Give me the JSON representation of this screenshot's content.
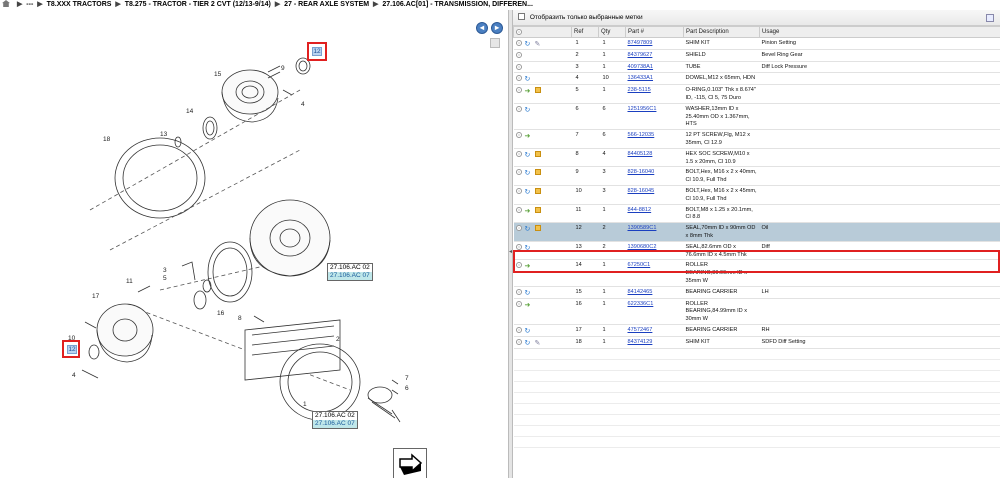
{
  "breadcrumb": {
    "items": [
      "---",
      "T8.XXX TRACTORS",
      "T8.275 - TRACTOR - TIER 2 CVT (12/13-9/14)",
      "27 - REAR AXLE SYSTEM",
      "27.106.AC[01] - TRANSMISSION, DIFFEREN..."
    ]
  },
  "diagram": {
    "nav_prev": "◂",
    "nav_next": "▸",
    "labels": [
      "15",
      "9",
      "12",
      "14",
      "4",
      "13",
      "18",
      "3",
      "5",
      "11",
      "17",
      "16",
      "8",
      "2",
      "10",
      "12",
      "4",
      "7",
      "6",
      "1"
    ],
    "ref_box_1": {
      "code": "27.106.AC 02",
      "link": "27.106.AC 07"
    },
    "ref_box_2": {
      "code": "27.106.AC 02",
      "link": "27.106.AC 07"
    },
    "callout_top": "12",
    "callout_left": "12"
  },
  "table": {
    "filter_label": "Отобразить только выбранные метки",
    "columns": [
      "",
      "Ref",
      "Qty",
      "Part #",
      "Part Description",
      "Usage"
    ],
    "rows": [
      {
        "icons": [
          "cycle",
          "wrench"
        ],
        "ref": "1",
        "qty": "1",
        "part": "87497809",
        "desc": "SHIM KIT",
        "usage": "Pinion Setting"
      },
      {
        "icons": [],
        "ref": "2",
        "qty": "1",
        "part": "84379627",
        "desc": "SHIELD",
        "usage": "Bevel Ring Gear"
      },
      {
        "icons": [],
        "ref": "3",
        "qty": "1",
        "part": "409738A1",
        "desc": "TUBE",
        "usage": "Diff Lock Pressure"
      },
      {
        "icons": [
          "cycle"
        ],
        "ref": "4",
        "qty": "10",
        "part": "136433A1",
        "desc": "DOWEL,M12 x 65mm, HDN",
        "usage": ""
      },
      {
        "icons": [
          "cart",
          "box"
        ],
        "ref": "5",
        "qty": "1",
        "part": "238-5115",
        "desc": "O-RING,0.103\" Thk x 8.674\" ID, -115, Cl 5, 75 Duro",
        "usage": ""
      },
      {
        "icons": [
          "cycle"
        ],
        "ref": "6",
        "qty": "6",
        "part": "1251956C1",
        "desc": "WASHER,13mm ID x 25.40mm OD x 1.367mm, HTS",
        "usage": ""
      },
      {
        "icons": [
          "cart"
        ],
        "ref": "7",
        "qty": "6",
        "part": "566-12035",
        "desc": "12 PT SCREW,Flg, M12 x 35mm, Cl 12.9",
        "usage": ""
      },
      {
        "icons": [
          "cycle",
          "box"
        ],
        "ref": "8",
        "qty": "4",
        "part": "84405128",
        "desc": "HEX SOC SCREW,M10 x 1.5 x 20mm, Cl 10.9",
        "usage": ""
      },
      {
        "icons": [
          "cycle",
          "box"
        ],
        "ref": "9",
        "qty": "3",
        "part": "828-16040",
        "desc": "BOLT,Hex, M16 x 2 x 40mm, Cl 10.9, Full Thd",
        "usage": ""
      },
      {
        "icons": [
          "cycle",
          "box"
        ],
        "ref": "10",
        "qty": "3",
        "part": "828-16045",
        "desc": "BOLT,Hex, M16 x 2 x 45mm, Cl 10.9, Full Thd",
        "usage": ""
      },
      {
        "icons": [
          "cart",
          "box"
        ],
        "ref": "11",
        "qty": "1",
        "part": "844-8812",
        "desc": "BOLT,M8 x 1.25 x 20.1mm, Cl 8.8",
        "usage": ""
      },
      {
        "icons": [
          "cycle",
          "box"
        ],
        "ref": "12",
        "qty": "2",
        "part": "1390589C1",
        "desc": "SEAL,70mm ID x 90mm OD x 8mm Thk",
        "usage": "Oil",
        "selected": true
      },
      {
        "icons": [
          "cycle"
        ],
        "ref": "13",
        "qty": "2",
        "part": "1390680C2",
        "desc": "SEAL,82.6mm OD x 76.6mm ID x 4.5mm Thk",
        "usage": "Diff"
      },
      {
        "icons": [
          "cart"
        ],
        "ref": "14",
        "qty": "1",
        "part": "67250C1",
        "desc": "ROLLER BEARING,89.99mm ID x 35mm W",
        "usage": ""
      },
      {
        "icons": [
          "cycle"
        ],
        "ref": "15",
        "qty": "1",
        "part": "84142465",
        "desc": "BEARING CARRIER",
        "usage": "LH"
      },
      {
        "icons": [
          "cart"
        ],
        "ref": "16",
        "qty": "1",
        "part": "622336C1",
        "desc": "ROLLER BEARING,84.99mm ID x 30mm W",
        "usage": ""
      },
      {
        "icons": [
          "cycle"
        ],
        "ref": "17",
        "qty": "1",
        "part": "47572467",
        "desc": "BEARING CARRIER",
        "usage": "RH"
      },
      {
        "icons": [
          "cycle",
          "wrench"
        ],
        "ref": "18",
        "qty": "1",
        "part": "84374129",
        "desc": "SHIM KIT",
        "usage": "SDFD Diff Setting"
      }
    ],
    "empty_rows": 9
  }
}
